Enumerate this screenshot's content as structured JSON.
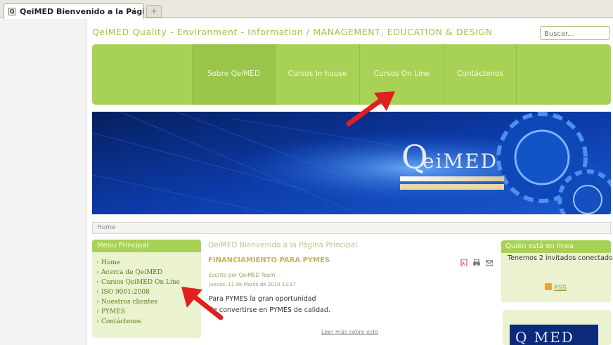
{
  "browser": {
    "tab_title": "QeiMED Bienvenido a la Página ...",
    "tab_favicon": "Q",
    "new_tab_symbol": "+"
  },
  "header": {
    "site_title": "QeiMED Quality - Environment - Information / MANAGEMENT, EDUCATION & DESIGN",
    "search_placeholder": "Buscar..."
  },
  "nav": {
    "items": [
      {
        "label": "Sobre QeiMED"
      },
      {
        "label": "Cursos In house"
      },
      {
        "label": "Cursos On Line"
      },
      {
        "label": "Contáctenos"
      }
    ]
  },
  "banner": {
    "logo_q": "Q",
    "logo_rest": "eiMED"
  },
  "breadcrumb": {
    "text": "Home"
  },
  "left_menu": {
    "title": "Menu Principal",
    "items": [
      {
        "label": "Home"
      },
      {
        "label": "Acerca de QeiMED"
      },
      {
        "label": "Cursos QeiMED On Line"
      },
      {
        "label": "ISO 9001:2008"
      },
      {
        "label": "Nuestros clientes"
      },
      {
        "label": "PYMES"
      },
      {
        "label": "Contáctenos"
      }
    ]
  },
  "article": {
    "page_heading": "QeiMED Bienvenido a la Página Principal",
    "title": "FINANCIAMIENTO PARA PYMES",
    "author": "Escrito por QeiMED Team",
    "date": "Jueves, 11 de Marzo de 2010 13:17",
    "body_line1": "Para PYMES la gran oportunidad",
    "body_line2": "de convertirse en PYMES de calidad.",
    "read_more": "Leer más sobre esto",
    "icons": [
      "pdf-icon",
      "print-icon",
      "email-icon"
    ]
  },
  "right_column": {
    "online_title": "Quién está en línea",
    "online_text": "Tenemos 2 invitados conectado",
    "rss_label": "RSS",
    "mini_logo_text": "Q  MED"
  },
  "colors": {
    "nav_green": "#a8d256",
    "title_green": "#9cc63a",
    "module_bg": "#eaf2cf",
    "banner_blue": "#0a2e88",
    "annotation_red": "#e02020"
  }
}
